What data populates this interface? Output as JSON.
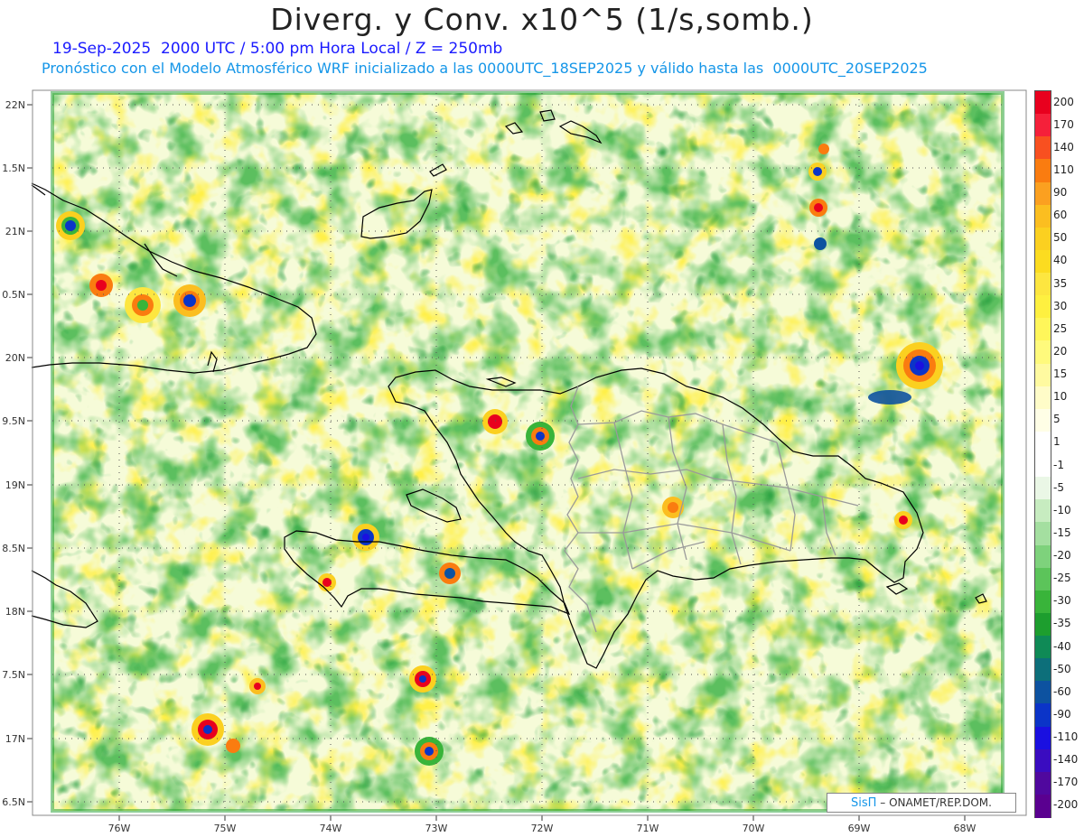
{
  "header": {
    "title": "Diverg. y Conv. x10^5 (1/s,somb.)",
    "subtitle_line1": "19-Sep-2025  2000 UTC / 5:00 pm Hora Local / Z = 250mb",
    "subtitle_line2": "Pronóstico con el Modelo Atmosférico WRF inicializado a las 0000UTC_18SEP2025 y válido hasta las  0000UTC_20SEP2025"
  },
  "map": {
    "lat_labels": [
      "22N",
      "1.5N",
      "21N",
      "0.5N",
      "20N",
      "9.5N",
      "19N",
      "8.5N",
      "18N",
      "7.5N",
      "17N",
      "6.5N"
    ],
    "lon_labels": [
      "76W",
      "75W",
      "74W",
      "73W",
      "72W",
      "71W",
      "70W",
      "69W",
      "68W"
    ],
    "colors": {
      "coastline": "#000000",
      "province_borders": "#9a9a9a",
      "grid": "#555555"
    }
  },
  "colorbar": {
    "labels": [
      "200",
      "170",
      "140",
      "110",
      "90",
      "60",
      "50",
      "40",
      "35",
      "30",
      "25",
      "20",
      "15",
      "10",
      "5",
      "1",
      "-1",
      "-5",
      "-10",
      "-15",
      "-20",
      "-25",
      "-30",
      "-35",
      "-40",
      "-50",
      "-60",
      "-90",
      "-110",
      "-140",
      "-170",
      "-200"
    ],
    "colors": [
      "#e8001e",
      "#f5203a",
      "#f85020",
      "#fa7c10",
      "#fba020",
      "#fbbe20",
      "#fbd020",
      "#fcdc20",
      "#fde640",
      "#fef040",
      "#fff65a",
      "#fffa7c",
      "#fffaa0",
      "#fffcc8",
      "#fffee6",
      "#ffffff",
      "#ffffff",
      "#eaf7e6",
      "#c7ecc0",
      "#a4dfa0",
      "#7ed27c",
      "#5cc45a",
      "#39b43a",
      "#1d9e2e",
      "#0f8a56",
      "#0d6f7a",
      "#0d52a0",
      "#0b34c8",
      "#1a10e0",
      "#3a0cc0",
      "#50089e",
      "#5a0090"
    ]
  },
  "credit": {
    "brand": "SisΠ",
    "text": "– ONAMET/REP.DOM."
  }
}
